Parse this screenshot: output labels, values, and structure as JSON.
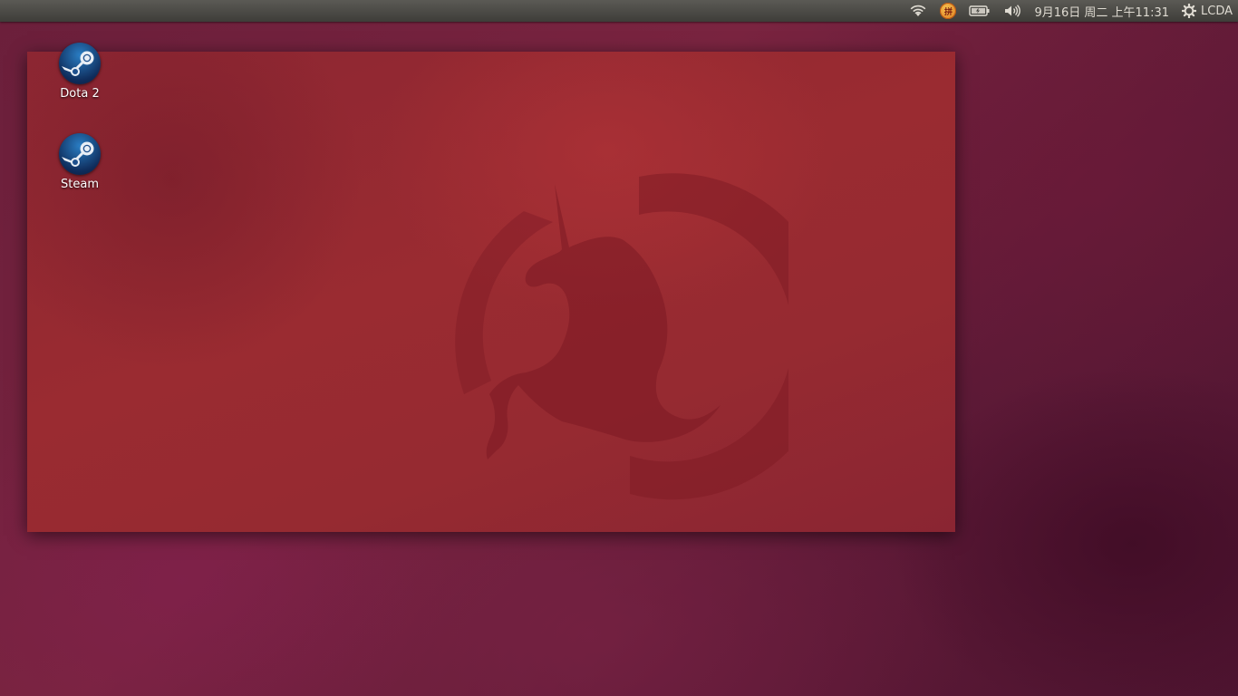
{
  "desktop": {
    "icons": [
      {
        "label": "Dota 2",
        "icon": "steam-icon"
      },
      {
        "label": "Steam",
        "icon": "steam-icon"
      }
    ]
  },
  "top_panel": {
    "indicators": {
      "network": "wifi-icon",
      "input_method": {
        "icon": "input-method-icon",
        "glyph": "拼"
      },
      "battery": "battery-icon",
      "sound": "volume-icon",
      "clock": "9月16日 周二 上午11:31",
      "session": {
        "icon": "gear-icon",
        "user": "LCDA"
      }
    }
  },
  "colors": {
    "panel": "#3e3d39",
    "wallpaper": "#6b1f3b",
    "preview_bg": "#962a31",
    "logo": "#7a1a24"
  }
}
